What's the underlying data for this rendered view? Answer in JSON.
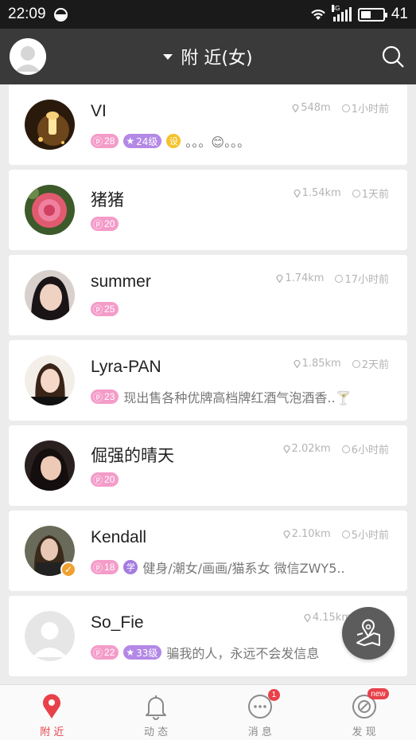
{
  "status_bar": {
    "time": "22:09",
    "network": "4G",
    "battery": "41"
  },
  "header": {
    "title": "附 近(女)"
  },
  "colors": {
    "accent": "#e8414a",
    "header_bg": "#3a3a3a",
    "badge_pink": "#f49cc9",
    "badge_purple": "#b388e6"
  },
  "users": [
    {
      "name": "VI",
      "distance": "548m",
      "time": "1小时前",
      "count": "28",
      "level": "24级",
      "tag": "设",
      "tag_color": "#f4c22b",
      "bio": "。。。😊。。。",
      "avatar": "night-lamp-photo"
    },
    {
      "name": "猪猪",
      "distance": "1.54km",
      "time": "1天前",
      "count": "20",
      "level": "",
      "tag": "",
      "bio": "",
      "avatar": "pink-flower-photo"
    },
    {
      "name": "summer",
      "distance": "1.74km",
      "time": "17小时前",
      "count": "25",
      "level": "",
      "tag": "",
      "bio": "",
      "avatar": "girl-portrait-photo"
    },
    {
      "name": "Lyra-PAN",
      "distance": "1.85km",
      "time": "2天前",
      "count": "23",
      "level": "",
      "tag": "",
      "bio": "现出售各种优牌高档牌红酒气泡酒香..🍸",
      "avatar": "girl-portrait-photo"
    },
    {
      "name": "倔强的晴天",
      "distance": "2.02km",
      "time": "6小时前",
      "count": "20",
      "level": "",
      "tag": "",
      "bio": "",
      "avatar": "girl-portrait-photo"
    },
    {
      "name": "Kendall",
      "distance": "2.10km",
      "time": "5小时前",
      "count": "18",
      "level": "",
      "tag": "学",
      "tag_color": "#a47be0",
      "bio": "健身/潮女/画画/猫系女 微信ZWY5..",
      "avatar": "girl-portrait-photo"
    },
    {
      "name": "So_Fie",
      "distance": "4.15km",
      "time": "",
      "count": "22",
      "level": "33级",
      "tag": "",
      "bio": "骗我的人，永远不会发信息",
      "avatar": "default-avatar"
    }
  ],
  "tabs": [
    {
      "label": "附 近",
      "icon": "location-pin-icon",
      "active": true
    },
    {
      "label": "动 态",
      "icon": "bell-icon",
      "active": false
    },
    {
      "label": "消 息",
      "icon": "chat-bubble-icon",
      "active": false,
      "badge": "1"
    },
    {
      "label": "发 现",
      "icon": "compass-icon",
      "active": false,
      "badge": "new"
    }
  ]
}
